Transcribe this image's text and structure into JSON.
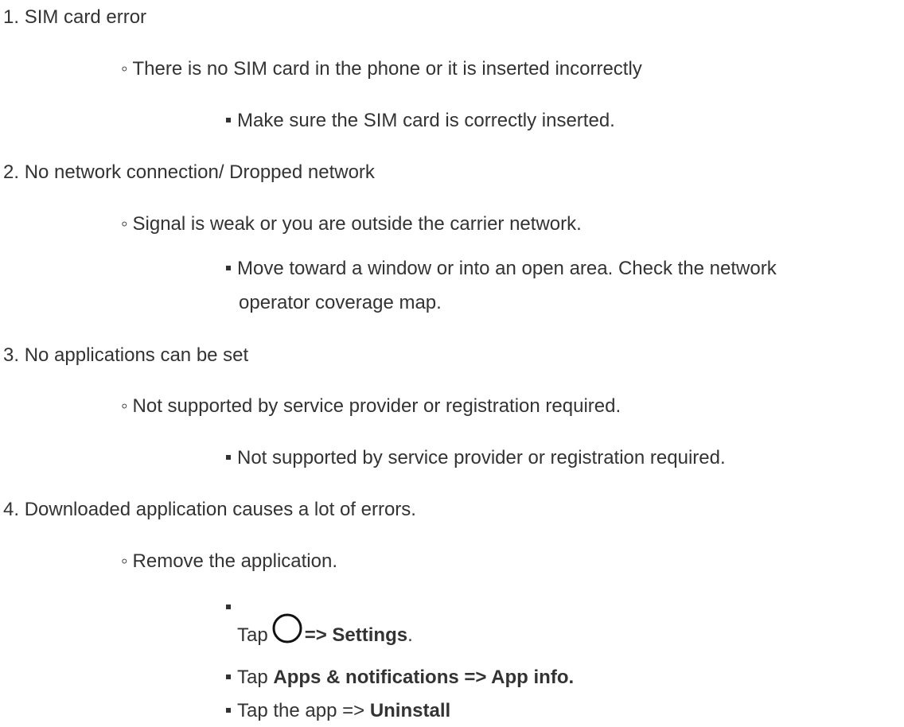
{
  "items": [
    {
      "number": "1.",
      "title": "SIM card error",
      "cause": "There is no SIM card in the phone or it is inserted incorrectly",
      "solution": "Make sure the SIM card is correctly inserted."
    },
    {
      "number": "2.",
      "title": "No network connection/ Dropped network",
      "cause": "Signal is weak or you are outside the carrier network.",
      "solution_line1": "Move toward a window or into an open area. Check the network",
      "solution_line2": "operator coverage map."
    },
    {
      "number": "3.",
      "title": "No applications can be set",
      "cause": "Not supported by service provider or registration required.",
      "solution": "Not supported by service provider or registration required."
    },
    {
      "number": "4.",
      "title": "Downloaded application causes a lot of errors.",
      "cause": "Remove the application.",
      "steps": [
        {
          "prefix": "Tap",
          "bold": "=> Settings",
          "suffix": "."
        },
        {
          "prefix": "Tap",
          "bold": "Apps & notifications => App info.",
          "suffix": ""
        },
        {
          "prefix": "Tap the app =>",
          "bold": "Uninstall",
          "suffix": ""
        }
      ]
    }
  ],
  "icons": {
    "home": "circle-home-icon"
  },
  "colors": {
    "text": "#333333"
  }
}
